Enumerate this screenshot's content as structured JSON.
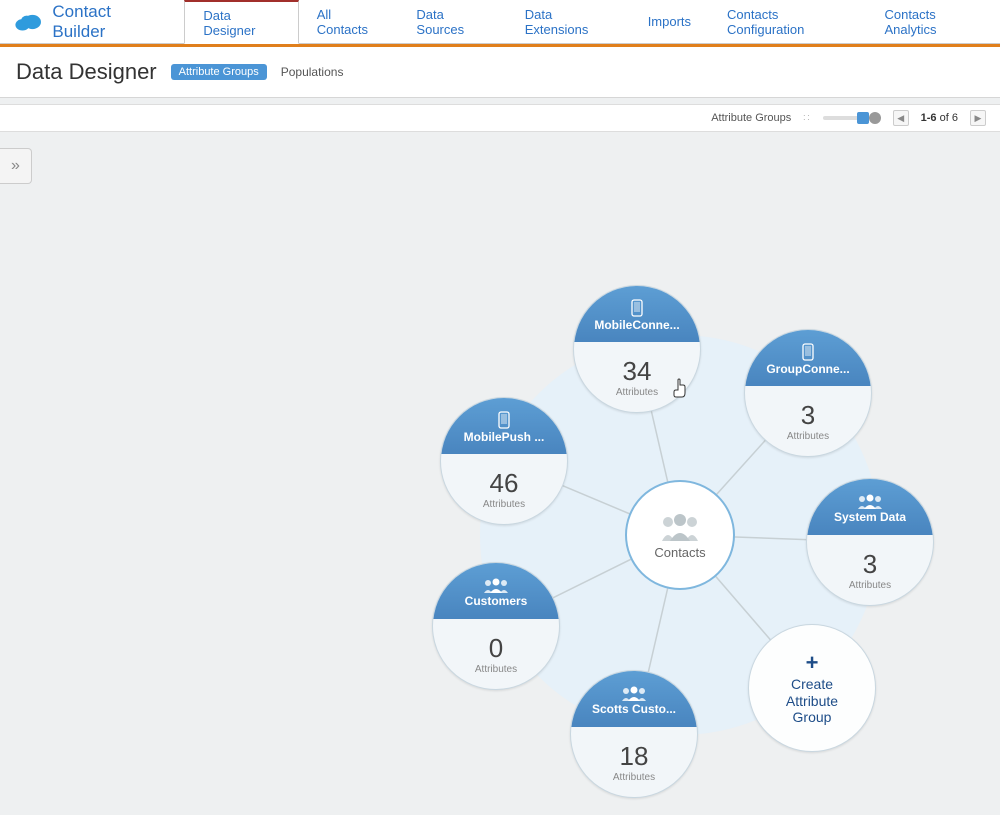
{
  "brand": "Contact Builder",
  "nav": {
    "tabs": [
      "Data Designer",
      "All Contacts",
      "Data Sources",
      "Data Extensions",
      "Imports",
      "Contacts Configuration",
      "Contacts Analytics"
    ],
    "active_index": 0
  },
  "page": {
    "title": "Data Designer",
    "subtabs": {
      "active": "Attribute Groups",
      "other": "Populations"
    }
  },
  "toolbar": {
    "label": "Attribute Groups",
    "pager": {
      "range": "1-6",
      "of_label": "of",
      "total": "6"
    }
  },
  "center": {
    "label": "Contacts"
  },
  "attributes_label": "Attributes",
  "nodes": {
    "mobile": {
      "name": "MobileConne...",
      "count": "34",
      "icon": "phone"
    },
    "group": {
      "name": "GroupConne...",
      "count": "3",
      "icon": "phone"
    },
    "push": {
      "name": "MobilePush ...",
      "count": "46",
      "icon": "phone"
    },
    "system": {
      "name": "System Data",
      "count": "3",
      "icon": "people"
    },
    "cust": {
      "name": "Customers",
      "count": "0",
      "icon": "people"
    },
    "scotts": {
      "name": "Scotts Custo...",
      "count": "18",
      "icon": "people"
    }
  },
  "create": {
    "line1": "Create",
    "line2": "Attribute",
    "line3": "Group"
  }
}
